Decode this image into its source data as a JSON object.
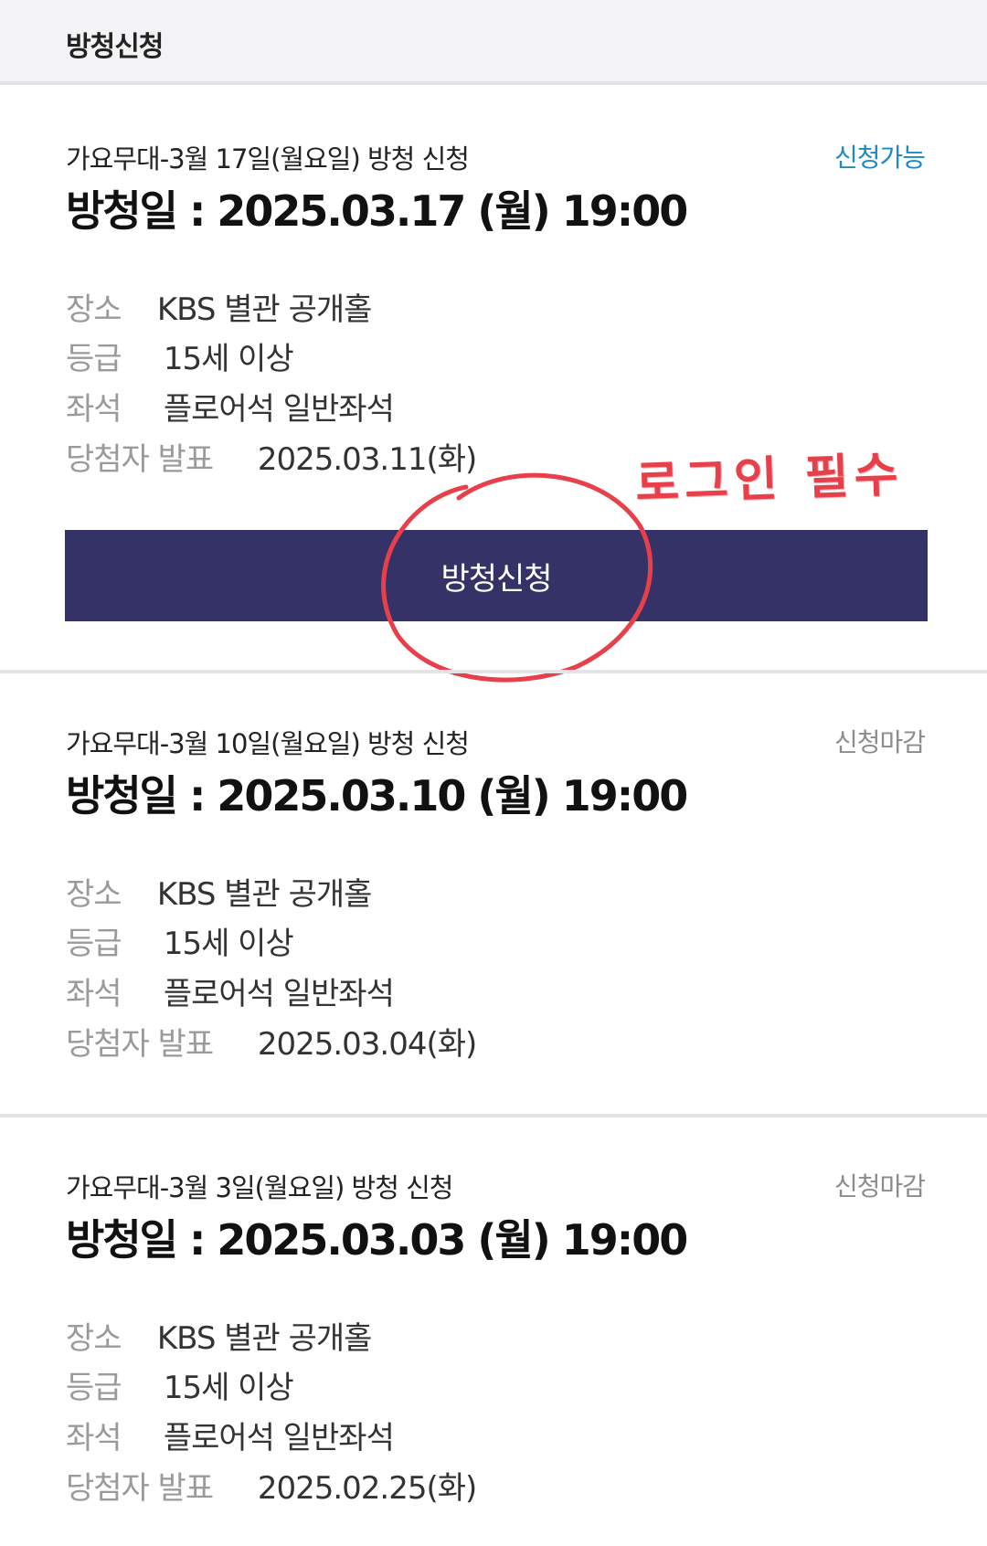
{
  "header": {
    "title": "방청신청"
  },
  "cards": [
    {
      "title": "가요무대-3월 17일(월요일) 방청 신청",
      "status": "신청가능",
      "date": "방청일 : 2025.03.17 (월) 19:00",
      "place_label": "장소",
      "place_value": "KBS 별관 공개홀",
      "grade_label": "등급",
      "grade_value": "15세 이상",
      "seat_label": "좌석",
      "seat_value": "플로어석 일반좌석",
      "winner_label": "당첨자 발표",
      "winner_value": "2025.03.11(화)",
      "button_label": "방청신청",
      "annotation": "로그인 필수"
    },
    {
      "title": "가요무대-3월 10일(월요일) 방청 신청",
      "status": "신청마감",
      "date": "방청일 : 2025.03.10 (월) 19:00",
      "place_label": "장소",
      "place_value": "KBS 별관 공개홀",
      "grade_label": "등급",
      "grade_value": "15세 이상",
      "seat_label": "좌석",
      "seat_value": "플로어석 일반좌석",
      "winner_label": "당첨자 발표",
      "winner_value": "2025.03.04(화)"
    },
    {
      "title": "가요무대-3월 3일(월요일) 방청 신청",
      "status": "신청마감",
      "date": "방청일 : 2025.03.03 (월) 19:00",
      "place_label": "장소",
      "place_value": "KBS 별관 공개홀",
      "grade_label": "등급",
      "grade_value": "15세 이상",
      "seat_label": "좌석",
      "seat_value": "플로어석 일반좌석",
      "winner_label": "당첨자 발표",
      "winner_value": "2025.02.25(화)"
    }
  ],
  "colors": {
    "button_bg": "#343266",
    "status_open": "#1a8ac4",
    "status_closed": "#8c8c8c",
    "annotation": "#e8404a"
  }
}
